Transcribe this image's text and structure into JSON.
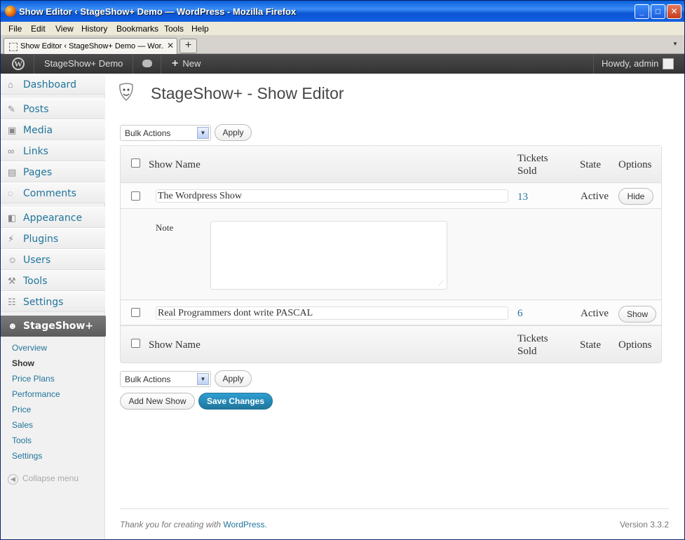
{
  "window": {
    "title": "Show Editor ‹ StageShow+ Demo — WordPress - Mozilla Firefox"
  },
  "menu": [
    "File",
    "Edit",
    "View",
    "History",
    "Bookmarks",
    "Tools",
    "Help"
  ],
  "tab": {
    "title": "Show Editor ‹ StageShow+ Demo — Wor..."
  },
  "adminbar": {
    "site": "StageShow+ Demo",
    "new": "New",
    "howdy": "Howdy, admin"
  },
  "sidebar": {
    "items": [
      "Dashboard",
      "Posts",
      "Media",
      "Links",
      "Pages",
      "Comments",
      "Appearance",
      "Plugins",
      "Users",
      "Tools",
      "Settings",
      "StageShow+"
    ],
    "submenu": [
      "Overview",
      "Show",
      "Price Plans",
      "Performance",
      "Price",
      "Sales",
      "Tools",
      "Settings"
    ],
    "collapse": "Collapse menu"
  },
  "page": {
    "title": "StageShow+ - Show Editor"
  },
  "bulk": {
    "label": "Bulk Actions",
    "apply": "Apply"
  },
  "table": {
    "headers": {
      "name": "Show Name",
      "sold1": "Tickets",
      "sold2": "Sold",
      "state": "State",
      "options": "Options"
    },
    "rows": [
      {
        "name": "The Wordpress Show",
        "sold": "13",
        "state": "Active",
        "action": "Hide",
        "note_label": "Note"
      },
      {
        "name": "Real Programmers dont write PASCAL",
        "sold": "6",
        "state": "Active",
        "action": "Show"
      }
    ]
  },
  "actions": {
    "add": "Add New Show",
    "save": "Save Changes"
  },
  "footer": {
    "thanks": "Thank you for creating with",
    "wp": "WordPress.",
    "version": "Version 3.3.2"
  },
  "colors": {
    "link": "#21759b",
    "admin_bar": "#464646",
    "titlebar": "#0a5fd8"
  }
}
